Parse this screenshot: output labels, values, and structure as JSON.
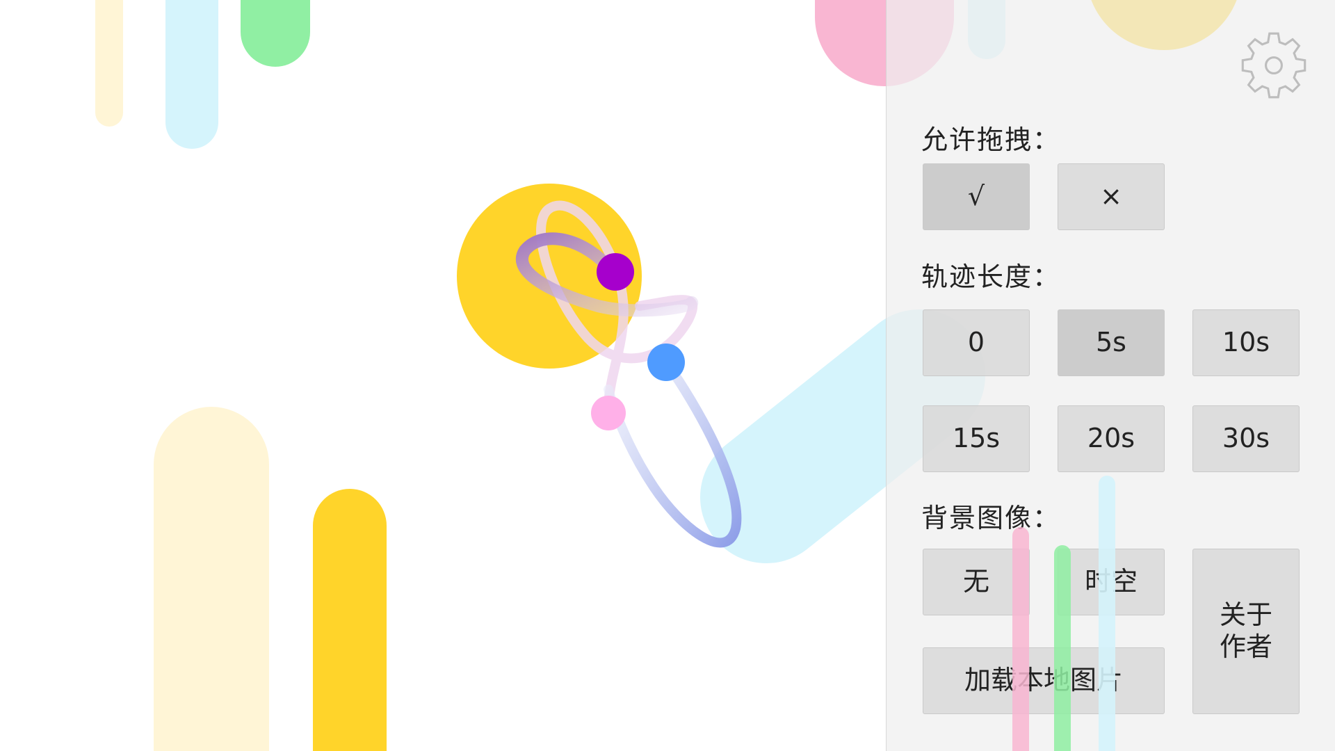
{
  "settings": {
    "drag_label": "允许拖拽：",
    "drag_options": [
      "√",
      "×"
    ],
    "trail_label": "轨迹长度：",
    "trail_options": [
      "0",
      "5s",
      "10s",
      "15s",
      "20s",
      "30s"
    ],
    "trail_selected": "5s",
    "background_label": "背景图像：",
    "bg_none": "无",
    "bg_spacetime": "时空",
    "load_local_image": "加载本地图片",
    "about_author": "关于\n作者",
    "gear_icon": "gear-icon"
  },
  "colors": {
    "yellow": "#FFD42A",
    "light_yellow": "#FFF5D6",
    "light_blue": "#D5F4FC",
    "green": "#90EFA3",
    "pink": "#F9B6D2",
    "body_purple": "#A600CC",
    "body_blue": "#4F9BFF",
    "body_pink": "#FFB0E8"
  }
}
